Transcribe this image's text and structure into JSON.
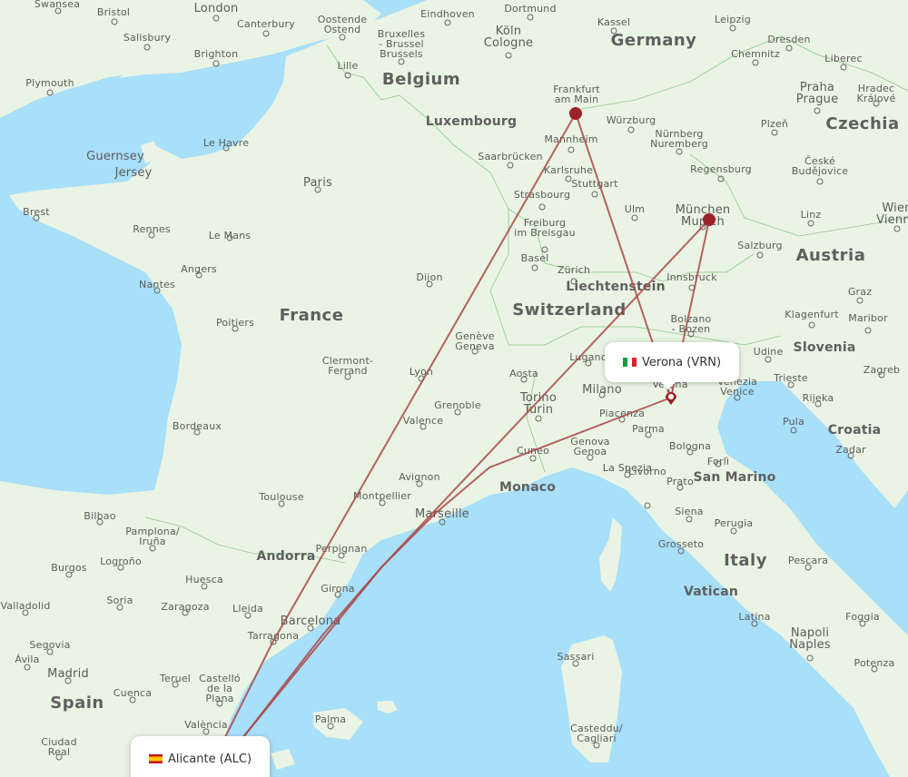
{
  "map": {
    "colors": {
      "sea": "#a8dff9",
      "land": "#eaf4e4",
      "route": "#a94848",
      "marker": "#9b2226",
      "border": "#8cc98a"
    },
    "countries": [
      "Germany",
      "Belgium",
      "France",
      "Switzerland",
      "Austria",
      "Czechia",
      "Italy",
      "Spain",
      "Slovenia",
      "Croatia",
      "Liechtenstein",
      "Luxembourg",
      "Andorra",
      "Monaco",
      "San Marino",
      "Vatican"
    ],
    "cities": [
      "Swansea",
      "Bristol",
      "London",
      "Canterbury",
      "Salisbury",
      "Brighton",
      "Plymouth",
      "Oostende Ostend",
      "Bruxelles - Brussel Brussels",
      "Lille",
      "Eindhoven",
      "Dortmund",
      "Köln Cologne",
      "Kassel",
      "Leipzig",
      "Dresden",
      "Chemnitz",
      "Liberec",
      "Praha Prague",
      "Hradec Králové",
      "Plzeň",
      "České Budějovice",
      "Frankfurt am Main",
      "Würzburg",
      "Nürnberg Nuremberg",
      "Mannheim",
      "Saarbrücken",
      "Karlsruhe",
      "Stuttgart",
      "Strasbourg",
      "Regensburg",
      "Ulm",
      "München Munich",
      "Freiburg im Breisgau",
      "Basel",
      "Zürich",
      "Salzburg",
      "Linz",
      "Wien Vienna",
      "Innsbruck",
      "Graz",
      "Klagenfurt",
      "Maribor",
      "Zagreb",
      "Bolzano - Bozen",
      "Udine",
      "Trieste",
      "Rijeka",
      "Pula",
      "Zadar",
      "Venezia Venice",
      "Verona",
      "Milano",
      "Lugano",
      "Piacenza",
      "Parma",
      "Bologna",
      "Forlì",
      "Prato",
      "Genova Genoa",
      "La Spezia",
      "Livorno",
      "Siena",
      "Perugia",
      "Grosseto",
      "Pescara",
      "Latina",
      "Napoli Naples",
      "Foggia",
      "Potenza",
      "Sassari",
      "Casteddu/ Cagliari",
      "Torino Turin",
      "Aosta",
      "Cuneo",
      "Genève Geneva",
      "Grenoble",
      "Valence",
      "Lyon",
      "Dijon",
      "Avignon",
      "Marseille",
      "Montpellier",
      "Toulouse",
      "Perpignan",
      "Clermont- Ferrand",
      "Bordeaux",
      "Poitiers",
      "Nantes",
      "Angers",
      "Le Mans",
      "Rennes",
      "Brest",
      "Le Havre",
      "Paris",
      "Guernsey",
      "Jersey",
      "Bilbao",
      "Pamplona/ Iruña",
      "Logroño",
      "Burgos",
      "Valladolid",
      "Soria",
      "Huesca",
      "Zaragoza",
      "Lleida",
      "Girona",
      "Barcelona",
      "Tarragona",
      "Segovia",
      "Ávila",
      "Madrid",
      "Teruel",
      "Castelló de la Plana",
      "Cuenca",
      "València",
      "Ciudad Real",
      "Palma"
    ],
    "routes": [
      {
        "from": "Alicante",
        "to": "Verona",
        "via": ""
      },
      {
        "from": "Alicante",
        "to": "Frankfurt am Main",
        "via": ""
      },
      {
        "from": "Frankfurt am Main",
        "to": "Verona",
        "via": ""
      },
      {
        "from": "Alicante",
        "to": "München",
        "via": ""
      },
      {
        "from": "München",
        "to": "Verona",
        "via": ""
      }
    ],
    "airports": [
      {
        "id": "vrn",
        "label": "Verona (VRN)",
        "flag": "italy-flag-icon"
      },
      {
        "id": "alc",
        "label": "Alicante (ALC)",
        "flag": "spain-flag-icon"
      }
    ]
  }
}
